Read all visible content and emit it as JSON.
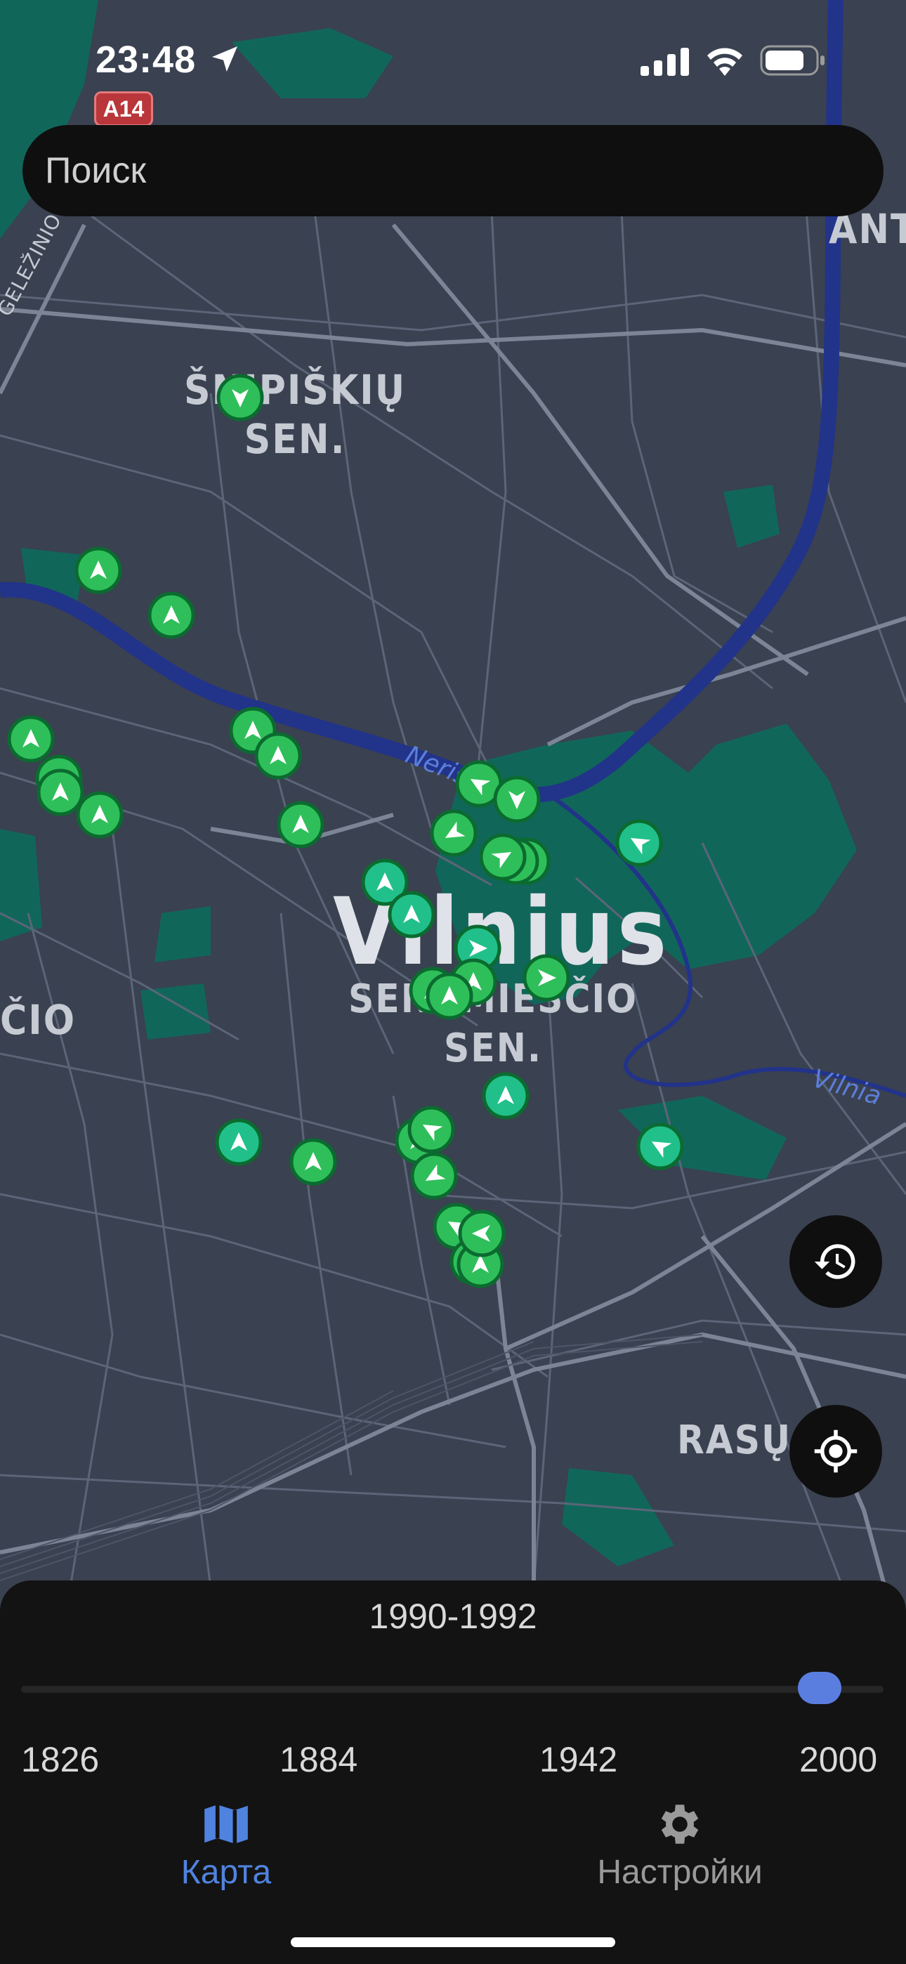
{
  "status_bar": {
    "time": "23:48",
    "road_badge": "A14"
  },
  "search": {
    "placeholder": "Поиск"
  },
  "map": {
    "labels": {
      "district_1_line1": "ŠNIPIŠKIŲ",
      "district_1_line2": "SEN.",
      "district_2": "ANTA",
      "city": "Vilnius",
      "old_town_line1": "SENAMIESČIO",
      "old_town_line2": "SEN.",
      "district_3": "ČIO",
      "district_4": "RASŲ S",
      "river_1": "Neris",
      "river_2": "Vilnia",
      "railway": "GELEŽINIO-VILK"
    },
    "marker_count": 44
  },
  "controls": {
    "history_icon": "history-icon",
    "locate_icon": "locate-icon"
  },
  "timeline": {
    "range_label": "1990-1992",
    "min": 1826,
    "max": 2000,
    "value": 1991,
    "ticks": [
      "1826",
      "1884",
      "1942",
      "2000"
    ]
  },
  "tab_bar": {
    "tabs": [
      {
        "label": "Карта",
        "icon": "map-icon",
        "active": true
      },
      {
        "label": "Настройки",
        "icon": "gear-icon",
        "active": false
      }
    ]
  },
  "colors": {
    "accent": "#4f83df",
    "marker": "#2fbf5a",
    "marker_teal": "#21c08a",
    "map_bg": "#3a4150",
    "river": "#22338a",
    "park": "#11665a"
  }
}
